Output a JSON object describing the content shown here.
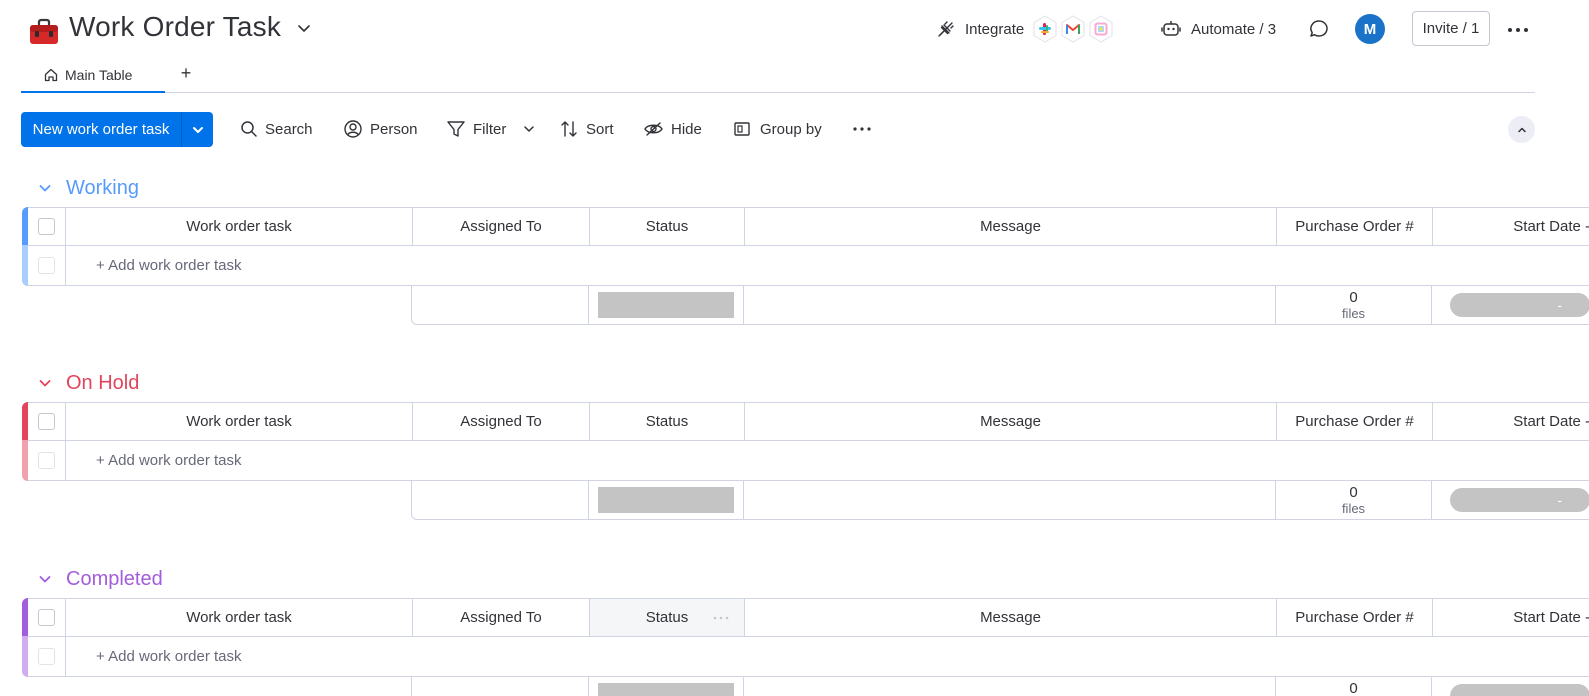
{
  "board": {
    "title": "Work Order Task",
    "icon": "briefcase-icon"
  },
  "header": {
    "integrate_label": "Integrate",
    "integrations": [
      "slack-icon",
      "gmail-icon",
      "calendar-icon"
    ],
    "automate_label": "Automate / 3",
    "avatar_initial": "M",
    "invite_label": "Invite / 1"
  },
  "tabs": {
    "main_label": "Main Table",
    "add_label": "+"
  },
  "toolbar": {
    "new_item_label": "New work order task",
    "search_label": "Search",
    "person_label": "Person",
    "filter_label": "Filter",
    "sort_label": "Sort",
    "hide_label": "Hide",
    "group_by_label": "Group by"
  },
  "columns": {
    "name": "Work order task",
    "assigned": "Assigned To",
    "status": "Status",
    "message": "Message",
    "purchase_order": "Purchase Order #",
    "start_date": "Start Date -"
  },
  "add_item_label": "+ Add work order task",
  "summary": {
    "files_count": "0",
    "files_unit": "files",
    "date_placeholder": "-"
  },
  "groups": [
    {
      "title": "Working",
      "color": "#579bfc",
      "light_color": "#a9cdfd"
    },
    {
      "title": "On Hold",
      "color": "#e2445c",
      "light_color": "#f0a1ad"
    },
    {
      "title": "Completed",
      "color": "#a25ddc",
      "light_color": "#d0aeed"
    }
  ],
  "colors": {
    "primary": "#0073ea",
    "status_empty": "#c4c4c4"
  }
}
